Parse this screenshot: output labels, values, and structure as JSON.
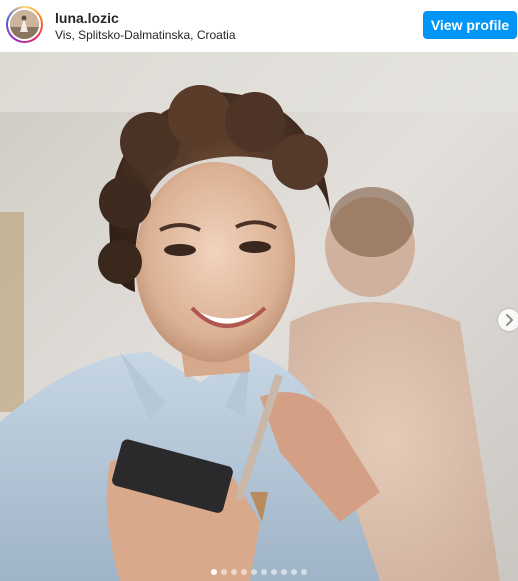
{
  "header": {
    "username": "luna.lozic",
    "location": "Vis, Splitsko-Dalmatinska, Croatia",
    "view_profile_label": "View profile"
  },
  "colors": {
    "button": "#0095f6",
    "text": "#262626"
  },
  "icons": {
    "avatar": "profile-avatar",
    "next": "chevron-right-icon"
  },
  "carousel": {
    "total_slides": 10,
    "active_index": 0
  }
}
